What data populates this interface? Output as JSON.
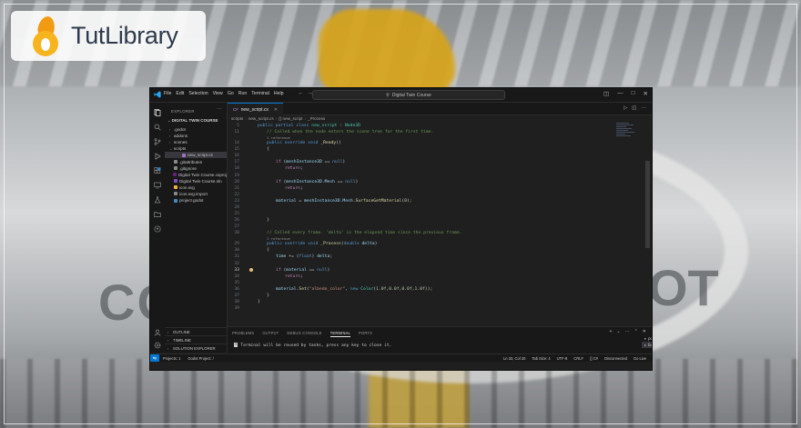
{
  "brand": {
    "name": "TutLibrary"
  },
  "background": {
    "left_text": "CO",
    "right_text": "OT",
    "right_sub": "e"
  },
  "window": {
    "menu": [
      "File",
      "Edit",
      "Selection",
      "View",
      "Go",
      "Run",
      "Terminal",
      "Help"
    ],
    "command_center": "Digital Twin Course"
  },
  "explorer": {
    "header": "EXPLORER",
    "root": "DIGITAL TWIN COURSE",
    "items": [
      {
        "label": ".godot",
        "type": "folder"
      },
      {
        "label": "addons",
        "type": "folder"
      },
      {
        "label": "scenes",
        "type": "folder"
      },
      {
        "label": "scripts",
        "type": "folder-open"
      },
      {
        "label": "new_script.cs",
        "type": "cs",
        "selected": true
      },
      {
        "label": ".gitattributes",
        "type": "file"
      },
      {
        "label": ".gitignore",
        "type": "file"
      },
      {
        "label": "Digital Twin Course.csproj",
        "type": "proj"
      },
      {
        "label": "Digital Twin Course.sln",
        "type": "sln"
      },
      {
        "label": "icon.svg",
        "type": "svg"
      },
      {
        "label": "icon.svg.import",
        "type": "file"
      },
      {
        "label": "project.godot",
        "type": "godot"
      }
    ],
    "sections": [
      "OUTLINE",
      "TIMELINE",
      "SOLUTION EXPLORER"
    ]
  },
  "editor": {
    "tab": {
      "badge": "C#",
      "label": "new_script.cs"
    },
    "breadcrumb": [
      "scripts",
      "new_script.cs",
      "{} new_script",
      "_Process"
    ],
    "breadcrumb_line2": "public partial class new_script : Node3D",
    "lens": "1 reference"
  },
  "panel": {
    "tabs": [
      "PROBLEMS",
      "OUTPUT",
      "DEBUG CONSOLE",
      "TERMINAL",
      "PORTS"
    ],
    "active_tab": "TERMINAL",
    "terminal_message": "Terminal will be reused by tasks, press any key to close it.",
    "terminal_list": [
      "powershell",
      "build"
    ]
  },
  "statusbar": {
    "left": [
      "Projects: 1",
      "Godot Project: /"
    ],
    "right": [
      "Ln 33, Col 20",
      "Tab Size: 4",
      "UTF-8",
      "CRLF",
      "{} C#",
      "Disconnected",
      "Go Live"
    ]
  },
  "colors": {
    "accent": "#0078d4",
    "editor_bg": "#1f1f1f",
    "sidebar_bg": "#181818"
  }
}
